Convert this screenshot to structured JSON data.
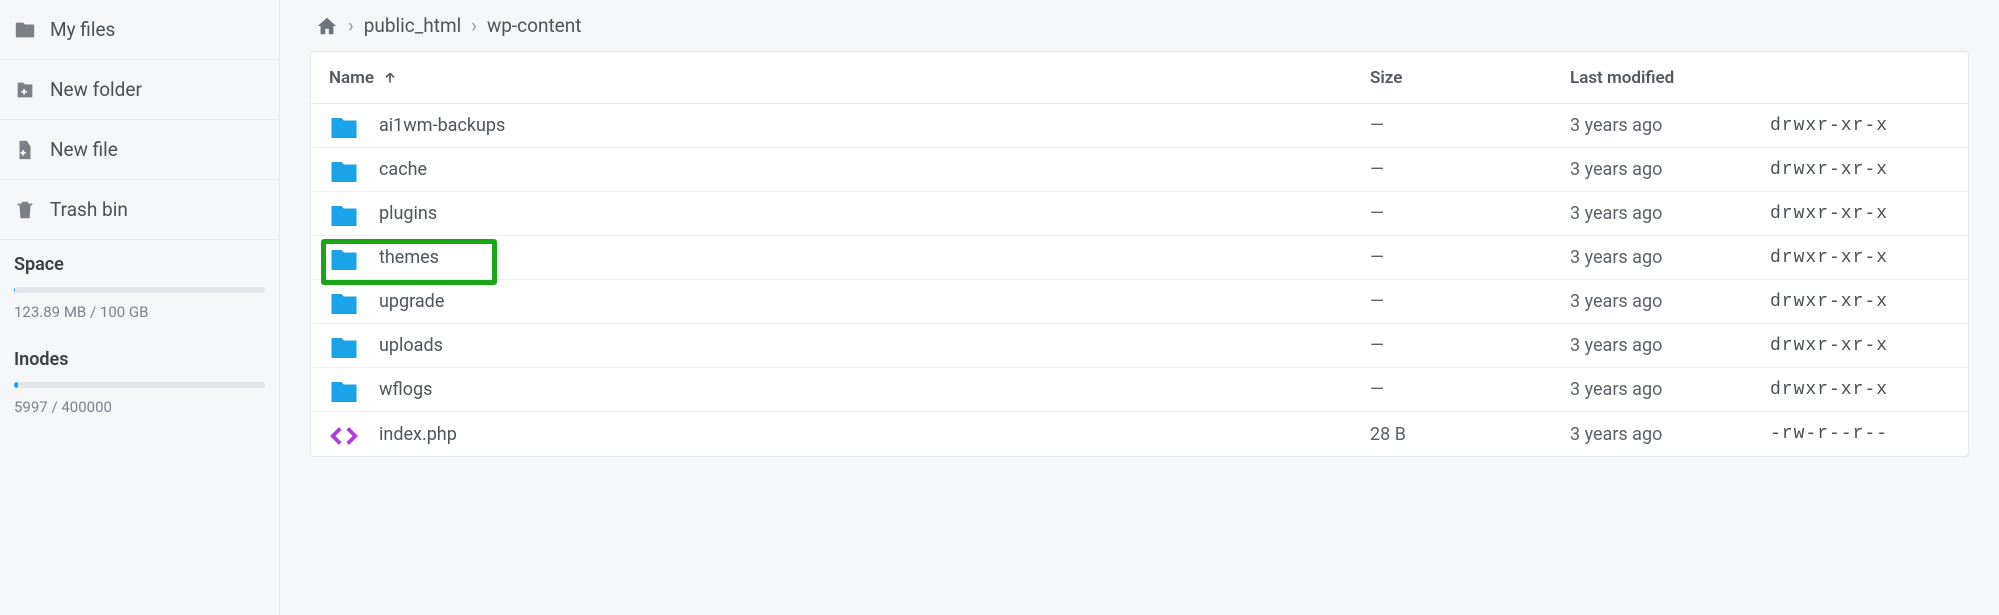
{
  "sidebar": {
    "items": [
      {
        "label": "My files",
        "icon": "folder-icon"
      },
      {
        "label": "New folder",
        "icon": "new-folder-icon"
      },
      {
        "label": "New file",
        "icon": "new-file-icon"
      },
      {
        "label": "Trash bin",
        "icon": "trash-icon"
      }
    ],
    "space": {
      "title": "Space",
      "text": "123.89 MB / 100 GB",
      "percent": 0.12
    },
    "inodes": {
      "title": "Inodes",
      "text": "5997 / 400000",
      "percent": 1.5
    }
  },
  "breadcrumb": {
    "items": [
      "public_html",
      "wp-content"
    ]
  },
  "table": {
    "headers": {
      "name": "Name",
      "size": "Size",
      "modified": "Last modified"
    },
    "rows": [
      {
        "name": "ai1wm-backups",
        "type": "folder",
        "size": "—",
        "modified": "3 years ago",
        "perm": "drwxr-xr-x",
        "highlight": false
      },
      {
        "name": "cache",
        "type": "folder",
        "size": "—",
        "modified": "3 years ago",
        "perm": "drwxr-xr-x",
        "highlight": false
      },
      {
        "name": "plugins",
        "type": "folder",
        "size": "—",
        "modified": "3 years ago",
        "perm": "drwxr-xr-x",
        "highlight": false
      },
      {
        "name": "themes",
        "type": "folder",
        "size": "—",
        "modified": "3 years ago",
        "perm": "drwxr-xr-x",
        "highlight": true
      },
      {
        "name": "upgrade",
        "type": "folder",
        "size": "—",
        "modified": "3 years ago",
        "perm": "drwxr-xr-x",
        "highlight": false
      },
      {
        "name": "uploads",
        "type": "folder",
        "size": "—",
        "modified": "3 years ago",
        "perm": "drwxr-xr-x",
        "highlight": false
      },
      {
        "name": "wflogs",
        "type": "folder",
        "size": "—",
        "modified": "3 years ago",
        "perm": "drwxr-xr-x",
        "highlight": false
      },
      {
        "name": "index.php",
        "type": "code",
        "size": "28 B",
        "modified": "3 years ago",
        "perm": "-rw-r--r--",
        "highlight": false
      }
    ]
  }
}
